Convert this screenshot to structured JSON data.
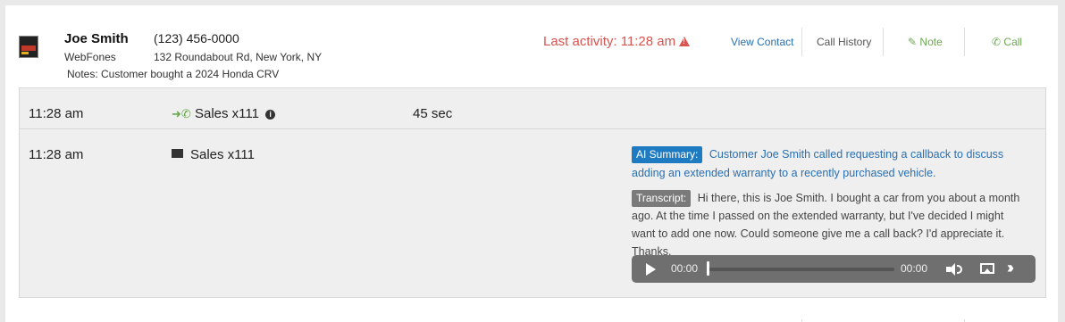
{
  "contact": {
    "name": "Joe Smith",
    "phone": "(123) 456-0000",
    "company": "WebFones",
    "address": "132 Roundabout Rd, New York, NY",
    "notes": "Notes: Customer bought a 2024 Honda CRV"
  },
  "last_activity": "Last activity: 11:28 am",
  "actions": {
    "view_contact": "View Contact",
    "call_history": "Call History",
    "note": "Note",
    "call": "Call"
  },
  "calls": [
    {
      "time": "11:28 am",
      "label": "Sales x111",
      "duration": "45 sec",
      "icon": "outgoing-call-icon"
    },
    {
      "time": "11:28 am",
      "label": "Sales x111",
      "icon": "voicemail-envelope-icon"
    }
  ],
  "ai_summary": {
    "badge": "AI Summary:",
    "text": "Customer Joe Smith called requesting a callback to discuss adding an extended warranty to a recently purchased vehicle."
  },
  "transcript": {
    "badge": "Transcript:",
    "text": "Hi there, this is Joe Smith. I bought a car from you about a month ago. At the time I passed on the extended warranty, but I've decided I might want to add one now. Could someone give me a call back? I'd appreciate it. Thanks."
  },
  "player": {
    "current": "00:00",
    "total": "00:00",
    "progress": 0
  },
  "colors": {
    "accent_green": "#6aa84f",
    "link_blue": "#2a6fb0",
    "warning_red": "#d9534f",
    "ai_badge": "#1f7bc1"
  }
}
